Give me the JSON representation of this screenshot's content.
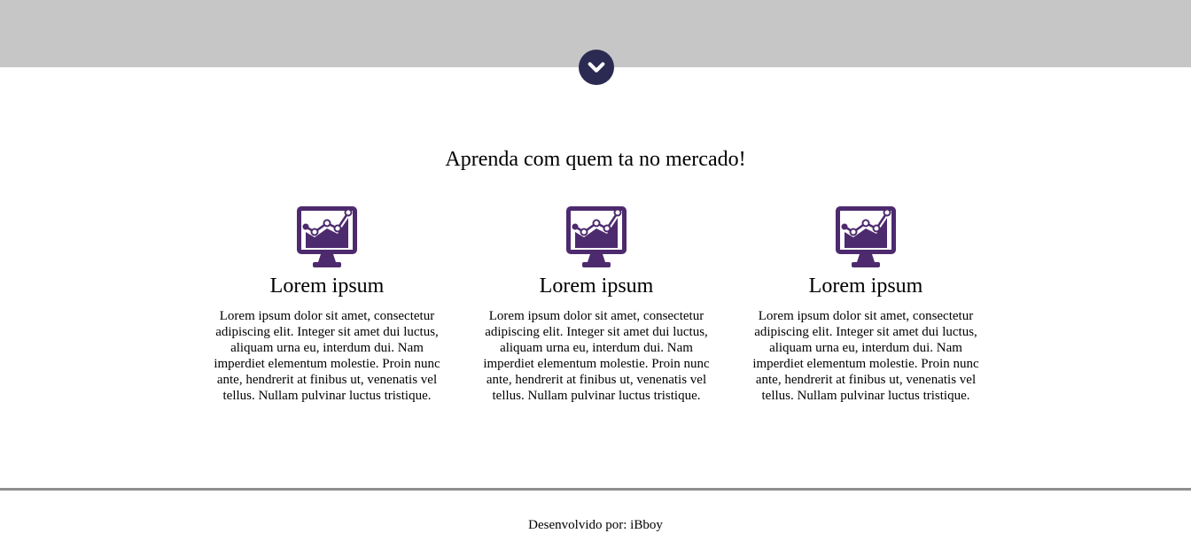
{
  "header": {
    "scroll_icon": "chevron-down-icon",
    "band_color": "#c6c6c6",
    "button_color": "#2b2a52"
  },
  "main": {
    "headline": "Aprenda com quem ta no mercado!",
    "features": [
      {
        "icon": "monitor-chart-icon",
        "title": "Lorem ipsum",
        "text": "Lorem ipsum dolor sit amet, consectetur adipiscing elit. Integer sit amet dui luctus, aliquam urna eu, interdum dui. Nam imperdiet elementum molestie. Proin nunc ante, hendrerit at finibus ut, venenatis vel tellus. Nullam pulvinar luctus tristique."
      },
      {
        "icon": "monitor-chart-icon",
        "title": "Lorem ipsum",
        "text": "Lorem ipsum dolor sit amet, consectetur adipiscing elit. Integer sit amet dui luctus, aliquam urna eu, interdum dui. Nam imperdiet elementum molestie. Proin nunc ante, hendrerit at finibus ut, venenatis vel tellus. Nullam pulvinar luctus tristique."
      },
      {
        "icon": "monitor-chart-icon",
        "title": "Lorem ipsum",
        "text": "Lorem ipsum dolor sit amet, consectetur adipiscing elit. Integer sit amet dui luctus, aliquam urna eu, interdum dui. Nam imperdiet elementum molestie. Proin nunc ante, hendrerit at finibus ut, venenatis vel tellus. Nullam pulvinar luctus tristique."
      }
    ],
    "icon_color": "#4d2a6e"
  },
  "footer": {
    "text": "Desenvolvido por: iBboy"
  }
}
